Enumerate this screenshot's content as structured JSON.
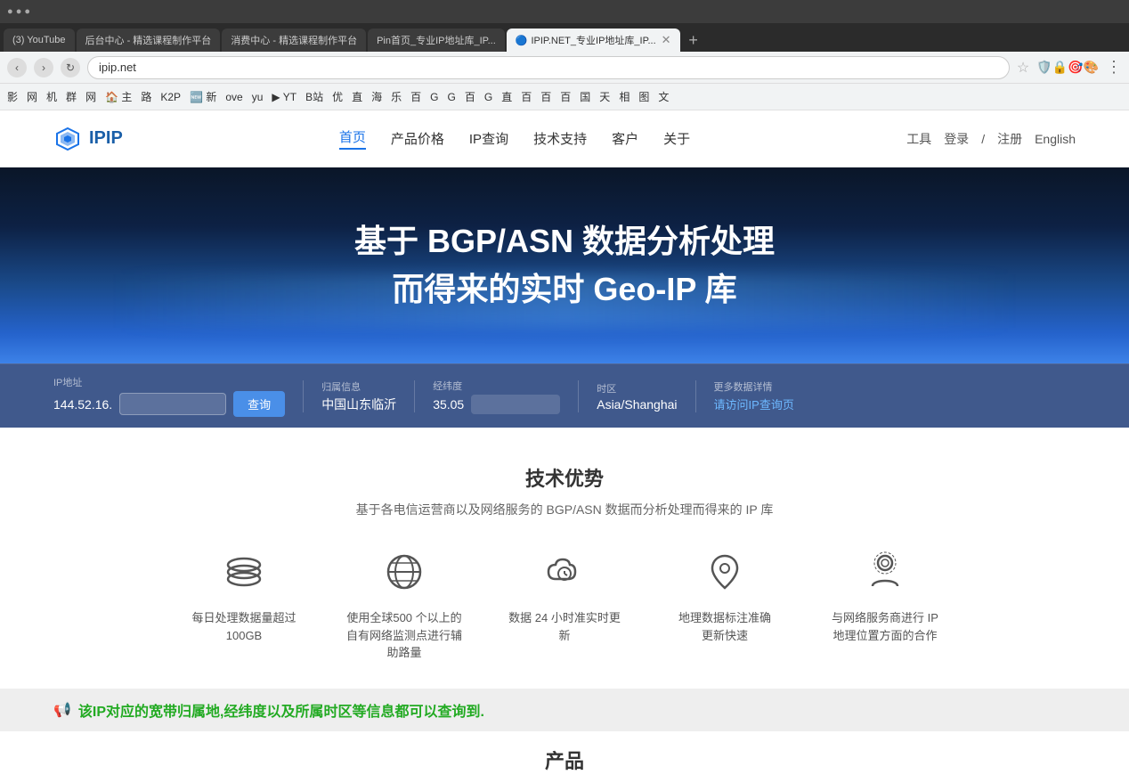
{
  "browser": {
    "tabs": [
      {
        "label": "(3) YouTube",
        "active": false
      },
      {
        "label": "后台中心 - 精选课程制作平台",
        "active": false
      },
      {
        "label": "消费中心 - 精选课程制作平台",
        "active": false
      },
      {
        "label": "Pin首页_专业IP地址库_IP...",
        "active": false
      },
      {
        "label": "IPIP.NET_专业IP地址库_IP...",
        "active": true
      }
    ],
    "address": "ipip.net",
    "bookmarks": [
      "影",
      "网",
      "机",
      "群",
      "网",
      "主",
      "路",
      "K2P",
      "新",
      "ove",
      "yu",
      "YT",
      "B站",
      "优",
      "直",
      "海",
      "乐",
      "百",
      "G",
      "G",
      "百",
      "G",
      "直",
      "百",
      "百",
      "百",
      "国",
      "天",
      "相",
      "图"
    ]
  },
  "header": {
    "logo_text": "IPIP",
    "nav_items": [
      {
        "label": "首页",
        "active": true
      },
      {
        "label": "产品价格",
        "active": false
      },
      {
        "label": "IP查询",
        "active": false
      },
      {
        "label": "技术支持",
        "active": false
      },
      {
        "label": "客户",
        "active": false
      },
      {
        "label": "关于",
        "active": false
      }
    ],
    "tools_label": "工具",
    "login_label": "登录",
    "register_label": "注册",
    "language_label": "English"
  },
  "hero": {
    "title_line1": "基于 BGP/ASN 数据分析处理",
    "title_line2": "而得来的实时 Geo-IP 库"
  },
  "ip_search": {
    "ip_label": "IP地址",
    "ip_value": "144.52.16.",
    "location_label": "归属信息",
    "location_value": "中国山东临沂",
    "longitude_label": "经纬度",
    "longitude_value": "35.05",
    "timezone_label": "时区",
    "timezone_value": "Asia/Shanghai",
    "more_label": "更多数据详情",
    "more_link": "请访问IP查询页"
  },
  "tech_section": {
    "title": "技术优势",
    "subtitle": "基于各电信运营商以及网络服务的 BGP/ASN 数据而分析处理而得来的 IP 库",
    "features": [
      {
        "icon": "layers",
        "text": "每日处理数据量超过\n100GB"
      },
      {
        "icon": "globe",
        "text": "使用全球500 个以上的\n自有网络监测点进行辅\n助路量"
      },
      {
        "icon": "clock-cloud",
        "text": "数据 24 小时准实时更\n新"
      },
      {
        "icon": "location",
        "text": "地理数据标注准确\n更新快速"
      },
      {
        "icon": "person-network",
        "text": "与网络服务商进行 IP\n地理位置方面的合作"
      }
    ]
  },
  "announcement": {
    "text": "该IP对应的宽带归属地,经纬度以及所属时区等信息都可以查询到."
  },
  "products": {
    "title": "产品"
  }
}
